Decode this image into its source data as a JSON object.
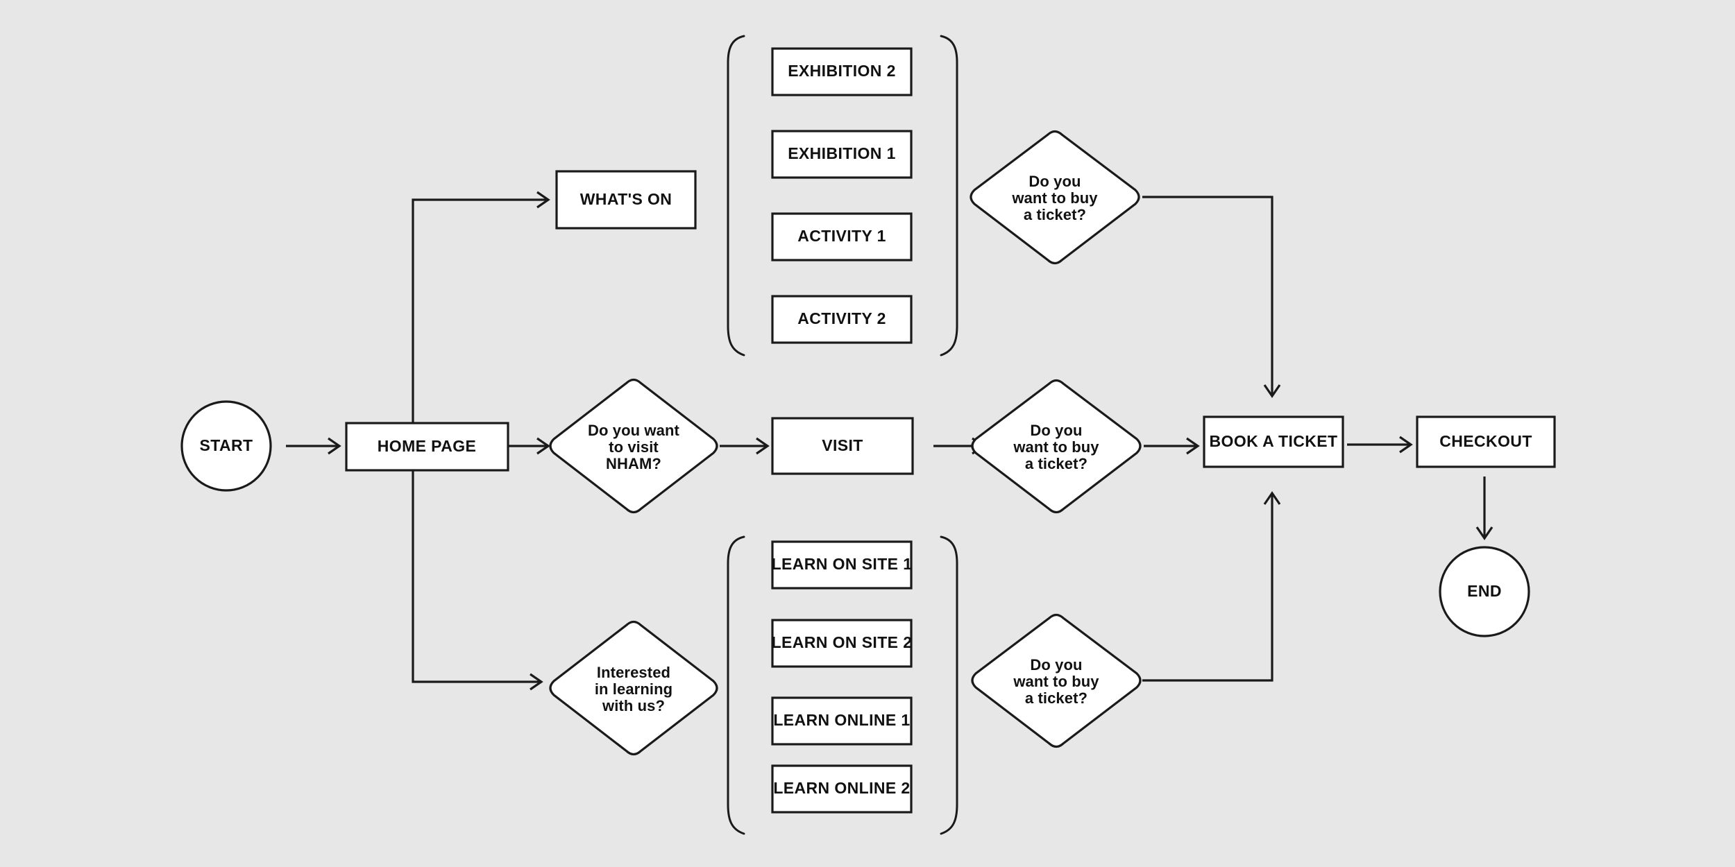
{
  "diagram": {
    "title": "NHAM website user journey flowchart",
    "background_color": "#e7e7e7",
    "shape_fill": "#ffffff",
    "stroke_color": "#1a1a1a"
  },
  "nodes": {
    "start": {
      "label": "START",
      "shape": "circle"
    },
    "home_page": {
      "label": "HOME PAGE",
      "shape": "rect"
    },
    "whats_on": {
      "label": "WHAT'S ON",
      "shape": "rect"
    },
    "visit_decision": {
      "shape": "diamond",
      "lines": [
        "Do you want",
        "to visit",
        "NHAM?"
      ]
    },
    "visit": {
      "label": "VISIT",
      "shape": "rect"
    },
    "learning_decision": {
      "shape": "diamond",
      "lines": [
        "Interested",
        "in learning",
        "with us?"
      ]
    },
    "ticket_decision_top": {
      "shape": "diamond",
      "lines": [
        "Do you",
        "want to buy",
        "a ticket?"
      ]
    },
    "ticket_decision_mid": {
      "shape": "diamond",
      "lines": [
        "Do you",
        "want to buy",
        "a ticket?"
      ]
    },
    "ticket_decision_bottom": {
      "shape": "diamond",
      "lines": [
        "Do you",
        "want to buy",
        "a ticket?"
      ]
    },
    "book_a_ticket": {
      "label": "BOOK A TICKET",
      "shape": "rect"
    },
    "checkout": {
      "label": "CHECKOUT",
      "shape": "rect"
    },
    "end": {
      "label": "END",
      "shape": "circle"
    }
  },
  "groups": {
    "whats_on_items": {
      "bracketed": true,
      "items": [
        {
          "label": "EXHIBITION 2"
        },
        {
          "label": "EXHIBITION 1"
        },
        {
          "label": "ACTIVITY 1"
        },
        {
          "label": "ACTIVITY 2"
        }
      ]
    },
    "learning_items": {
      "bracketed": true,
      "items": [
        {
          "label": "LEARN ON SITE 1"
        },
        {
          "label": "LEARN ON SITE 2"
        },
        {
          "label": "LEARN ONLINE 1"
        },
        {
          "label": "LEARN ONLINE 2"
        }
      ]
    }
  }
}
